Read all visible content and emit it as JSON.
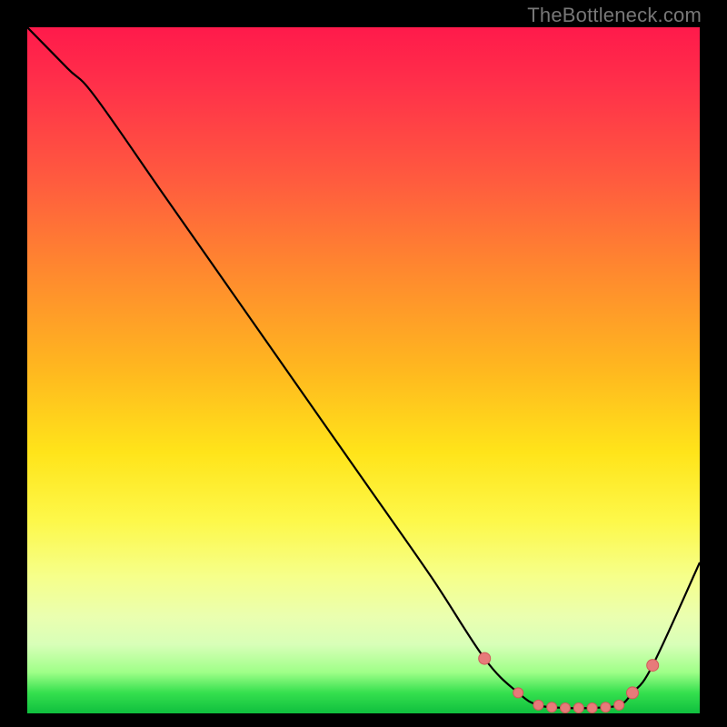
{
  "watermark": "TheBottleneck.com",
  "colors": {
    "curve": "#000000",
    "marker_fill": "#e77b7a",
    "marker_stroke": "#cf5b59"
  },
  "chart_data": {
    "type": "line",
    "title": "",
    "xlabel": "",
    "ylabel": "",
    "xlim": [
      0,
      100
    ],
    "ylim": [
      0,
      100
    ],
    "grid": false,
    "legend": false,
    "series": [
      {
        "name": "bottleneck-curve",
        "x": [
          0,
          6,
          10,
          20,
          30,
          40,
          50,
          60,
          68,
          73,
          76,
          80,
          84,
          88,
          90,
          93,
          100
        ],
        "y": [
          100,
          94,
          90,
          76,
          62,
          48,
          34,
          20,
          8,
          3,
          1.2,
          0.8,
          0.8,
          1.2,
          3,
          7,
          22
        ]
      }
    ],
    "annotations": {
      "markers_x": [
        68,
        73,
        76,
        78,
        80,
        82,
        84,
        86,
        88,
        90,
        93
      ],
      "markers_y": [
        8,
        3,
        1.2,
        0.9,
        0.8,
        0.8,
        0.8,
        0.9,
        1.2,
        3,
        7
      ]
    }
  }
}
